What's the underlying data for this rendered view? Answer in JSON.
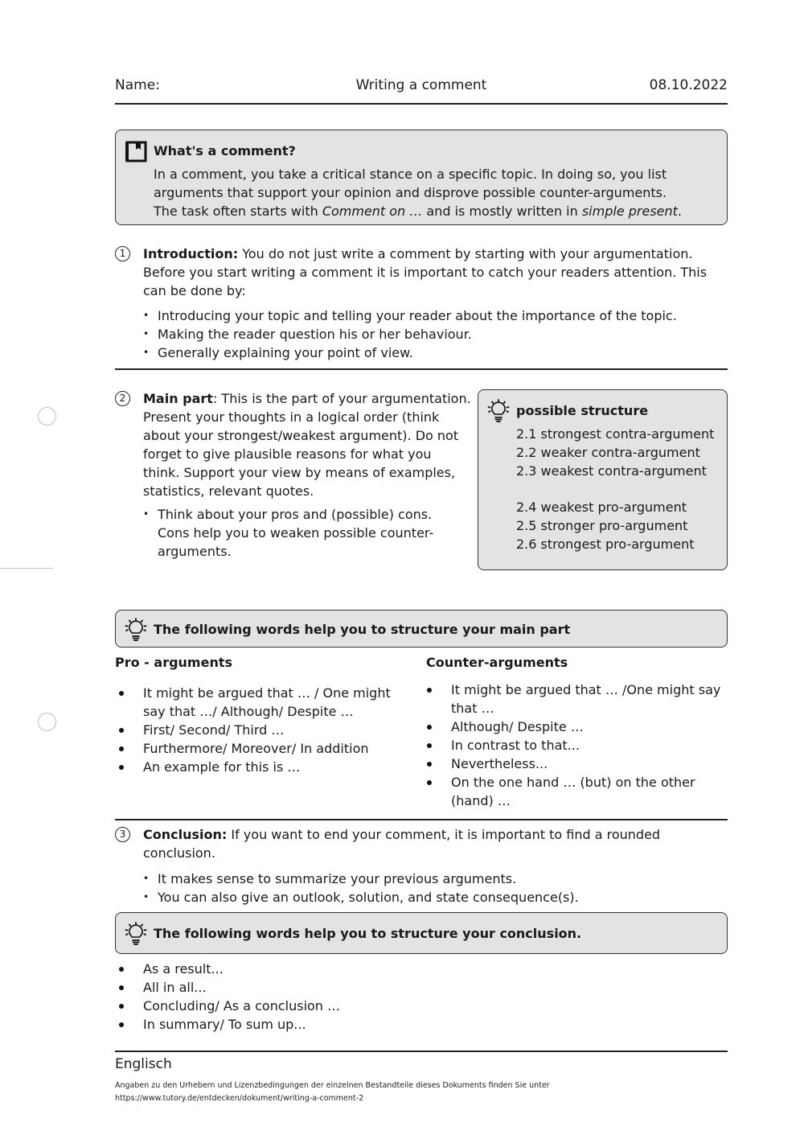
{
  "header": {
    "name_label": "Name:",
    "title": "Writing a comment",
    "date": "08.10.2022"
  },
  "info_box": {
    "icon": "book-bookmark-icon",
    "title": "What's a comment?",
    "line1": "In a comment, you take a critical stance on a specific topic. In doing so, you list",
    "line2": "arguments that support your opinion and disprove possible counter-arguments.",
    "line3_a": "The task often starts with ",
    "line3_italic1": "Comment on …",
    "line3_b": " and is mostly written in ",
    "line3_italic2": "simple present",
    "line3_c": "."
  },
  "section1": {
    "number": "1",
    "heading": "Introduction:",
    "text": " You do not just write a comment by starting with your argumentation. Before you start writing a comment it is important to catch your readers attention. This can be done by:",
    "bullets": [
      "Introducing your topic and telling your reader about the importance of the topic.",
      "Making the reader question his or her behaviour.",
      "Generally explaining your point of view."
    ]
  },
  "section2": {
    "number": "2",
    "heading": "Main part",
    "text": ": This is the part of your argumentation. Present your thoughts in a logical order (think about your strongest/weakest argument). Do not forget to give plausible reasons for what you think. Support your view by means of examples, statistics, relevant quotes.",
    "bullets": [
      "Think about your pros and (possible) cons. Cons help you to weaken possible counter-arguments."
    ],
    "structure_box": {
      "icon": "lightbulb-icon",
      "title": "possible structure",
      "contra": [
        "2.1 strongest contra-argument",
        "2.2 weaker contra-argument",
        "2.3 weakest contra-argument"
      ],
      "pro": [
        "2.4 weakest pro-argument",
        "2.5 stronger pro-argument",
        "2.6 strongest pro-argument"
      ]
    }
  },
  "main_words_box": {
    "icon": "lightbulb-icon",
    "title": "The following words help you to structure your main part"
  },
  "pro_arguments": {
    "heading": "Pro - arguments",
    "items": [
      "It might be argued that … / One might say that …/ Although/ Despite …",
      "First/ Second/ Third …",
      "Furthermore/ Moreover/ In addition",
      "An example for this is …"
    ]
  },
  "counter_arguments": {
    "heading": "Counter-arguments",
    "items": [
      "It might be argued that … /One might say that …",
      "Although/ Despite …",
      "In contrast to that...",
      "Nevertheless...",
      "On the one hand … (but) on the other (hand) …"
    ]
  },
  "section3": {
    "number": "3",
    "heading": "Conclusion:",
    "text": " If you want to end your comment, it is important to find a rounded conclusion.",
    "bullets": [
      "It makes sense to summarize your previous arguments.",
      "You can also give an outlook, solution, and state consequence(s)."
    ]
  },
  "conclusion_words_box": {
    "icon": "lightbulb-icon",
    "title": "The following words help you to structure your conclusion."
  },
  "conclusion_words": [
    "As a result...",
    "All in all...",
    "Concluding/ As a conclusion …",
    "In summary/ To sum up..."
  ],
  "footer": {
    "subject": "Englisch",
    "license_line": "Angaben zu den Urhebern und Lizenzbedingungen der einzelnen Bestandteile dieses Dokuments finden Sie unter",
    "url": "https://www.tutory.de/entdecken/dokument/writing-a-comment-2"
  }
}
